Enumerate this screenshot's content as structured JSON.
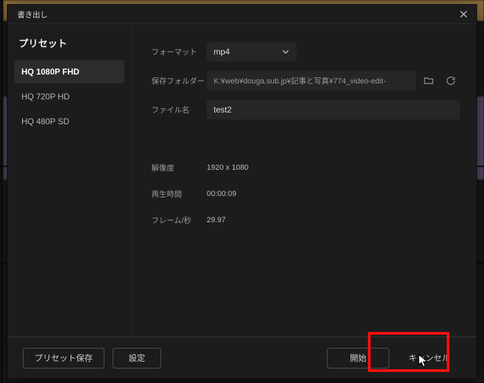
{
  "titlebar": {
    "title": "書き出し"
  },
  "sidebar": {
    "heading": "プリセット",
    "items": [
      {
        "label": "HQ 1080P FHD",
        "active": true
      },
      {
        "label": "HQ 720P HD",
        "active": false
      },
      {
        "label": "HQ 480P SD",
        "active": false
      }
    ]
  },
  "fields": {
    "format_label": "フォーマット",
    "format_value": "mp4",
    "folder_label": "保存フォルダー",
    "folder_value": "K:¥web¥douga.sub.jp¥記事と写真¥774_video-edit-",
    "filename_label": "ファイル名",
    "filename_value": "test2"
  },
  "info": {
    "resolution_label": "解像度",
    "resolution_value": "1920 x 1080",
    "duration_label": "再生時間",
    "duration_value": "00:00:09",
    "fps_label": "フレーム/秒",
    "fps_value": "29.97"
  },
  "footer": {
    "save_preset": "プリセット保存",
    "settings": "設定",
    "start": "開始",
    "cancel": "キャンセル"
  }
}
